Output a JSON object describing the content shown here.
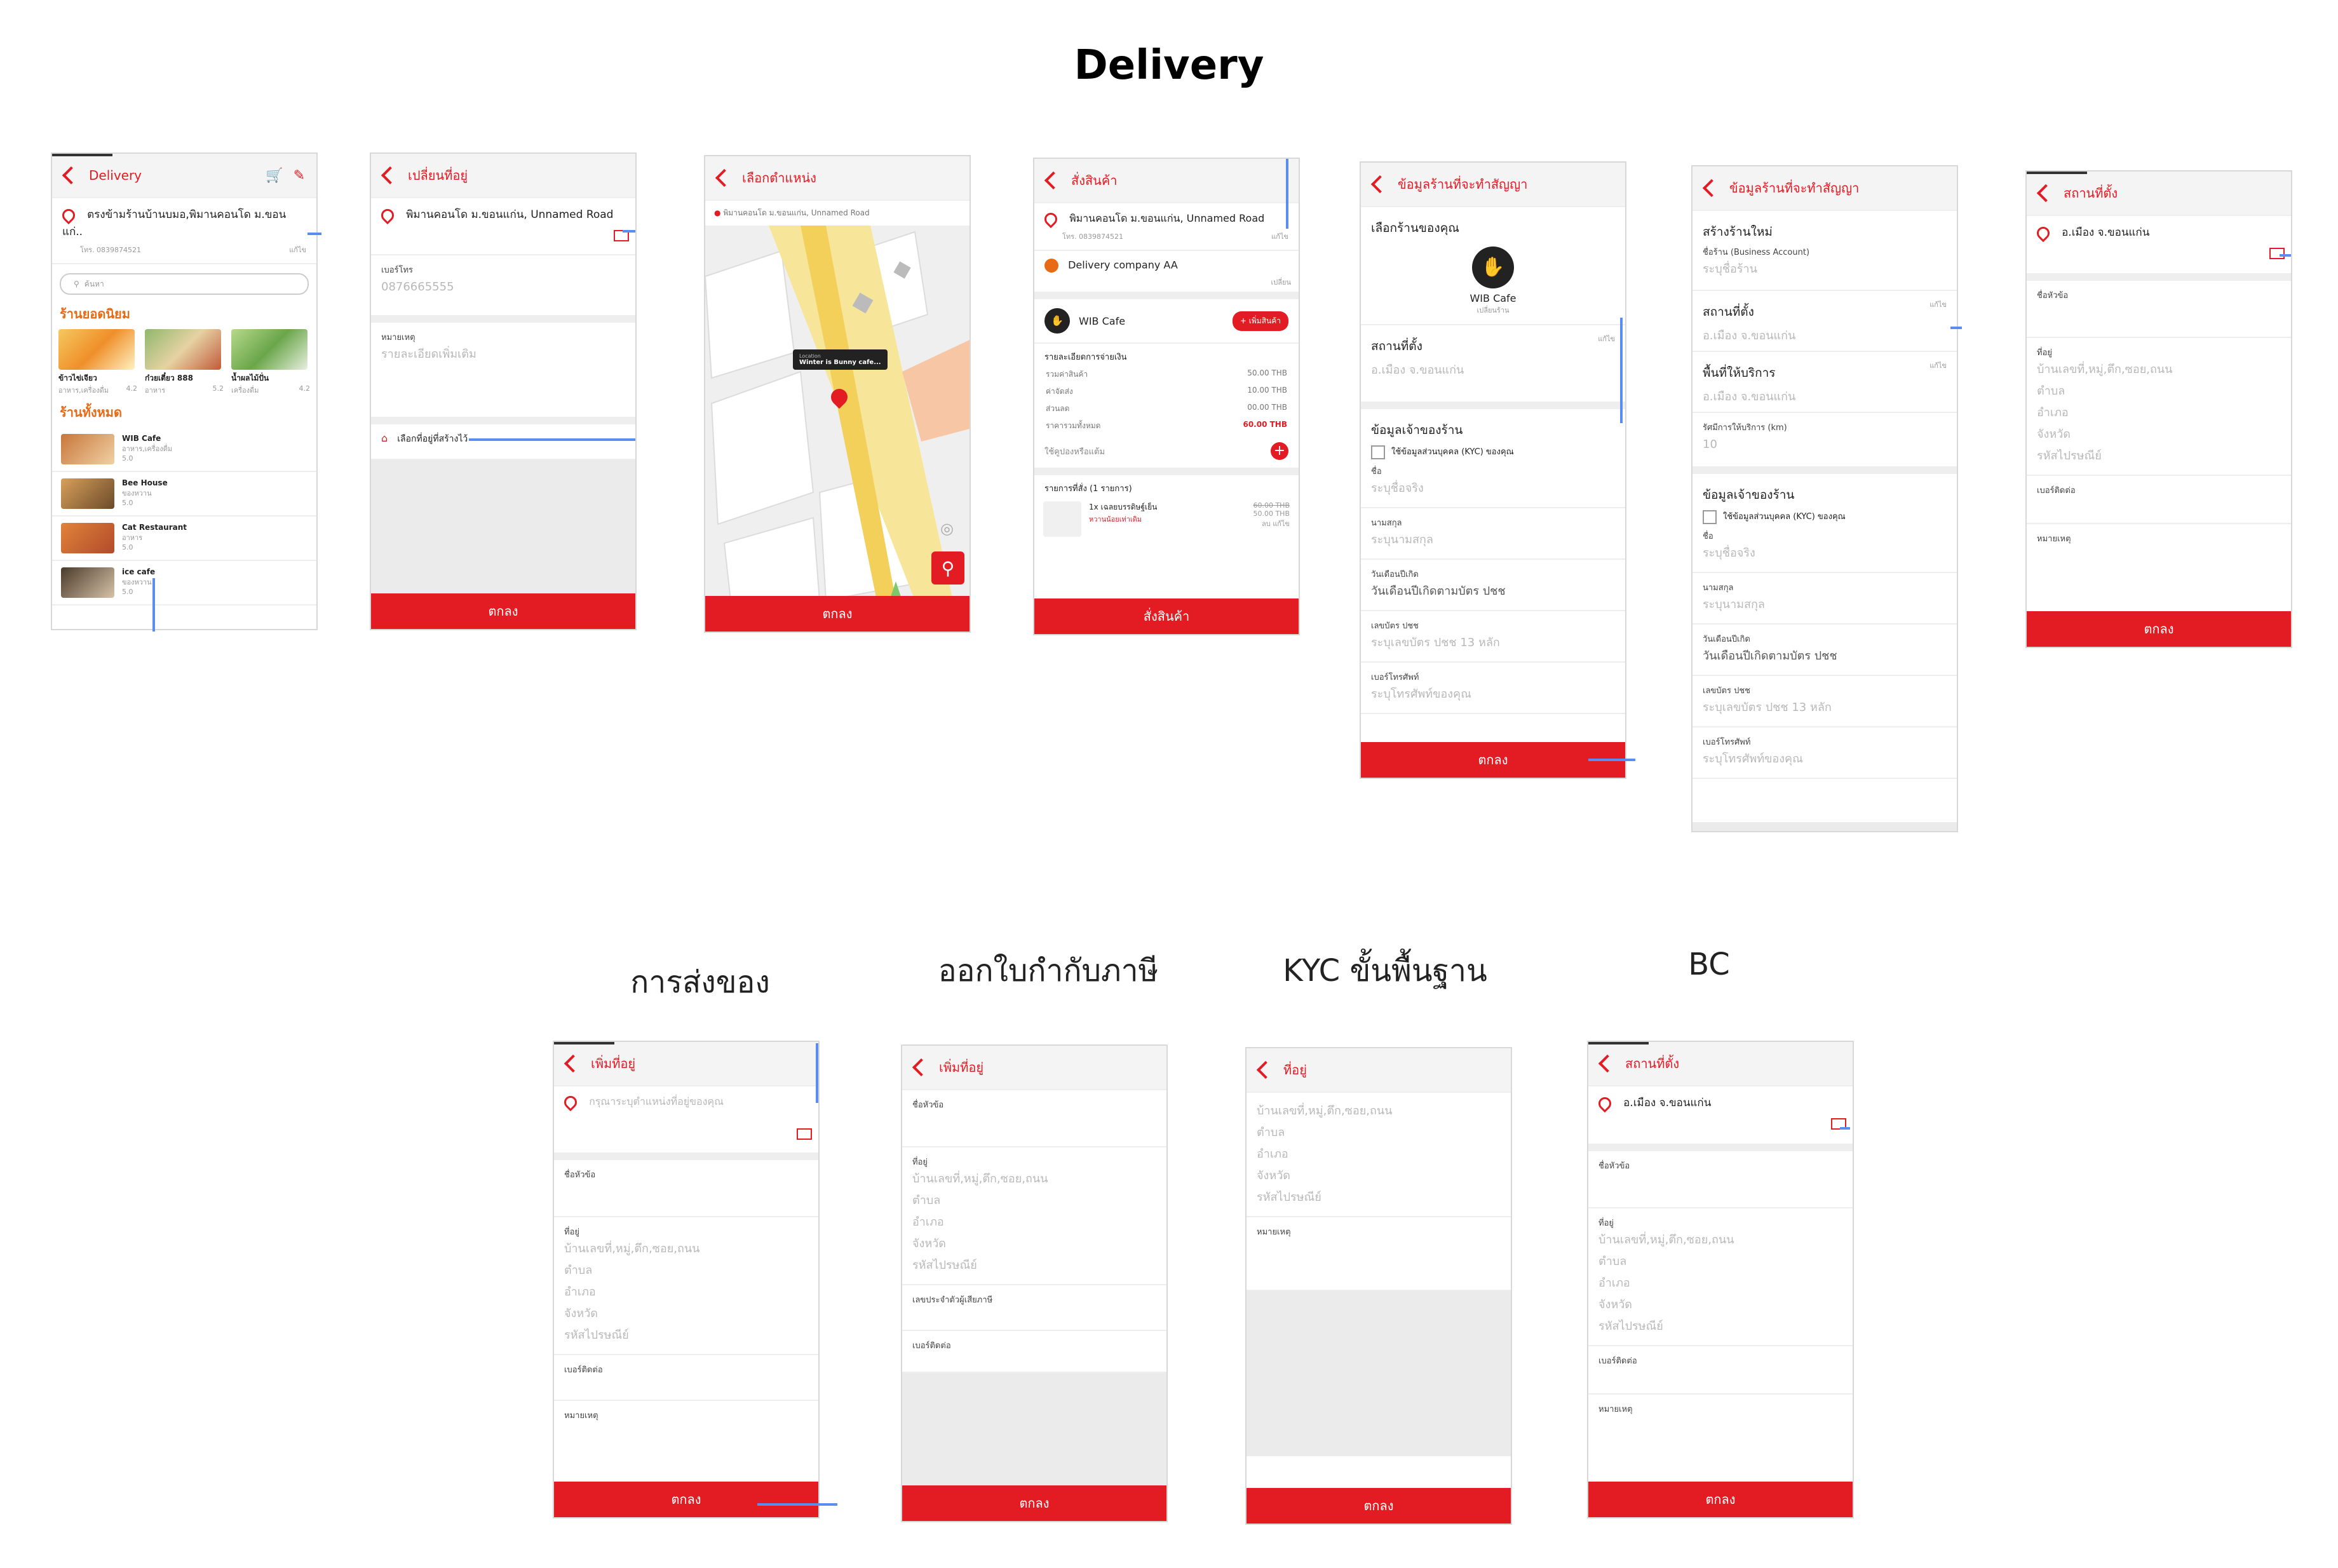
{
  "page_title": "Delivery",
  "section_titles": [
    "การส่งของ",
    "ออกใบกำกับภาษี",
    "KYC ขั้นพื้นฐาน",
    "BC"
  ],
  "s1": {
    "title": "Delivery",
    "address": "ตรงข้ามร้านบ้านบมอ,พิมานคอนโด ม.ขอนแก่..",
    "phone": "โทร. 0839874521",
    "edit": "แก้ไข",
    "search_placeholder": "ค้นหา",
    "popular_title": "ร้านยอดนิยม",
    "popular": [
      {
        "name": "ข้าวไข่เจียว",
        "sub": "อาหาร,เครื่องดื่ม",
        "rating": "4.2"
      },
      {
        "name": "ก๋วยเตี๋ยว 888",
        "sub": "อาหาร",
        "rating": "5.2"
      },
      {
        "name": "น้ำผลไม้ปั่น",
        "sub": "เครื่องดื่ม",
        "rating": "4.2"
      }
    ],
    "all_title": "ร้านทั้งหมด",
    "shops": [
      {
        "name": "WIB Cafe",
        "sub": "อาหาร,เครื่องดื่ม",
        "rating": "5.0"
      },
      {
        "name": "Bee House",
        "sub": "ของหวาน",
        "rating": "5.0"
      },
      {
        "name": "Cat Restaurant",
        "sub": "อาหาร",
        "rating": "5.0"
      },
      {
        "name": "ice cafe",
        "sub": "ของหวาน",
        "rating": "5.0"
      }
    ]
  },
  "s2": {
    "title": "เปลี่ยนที่อยู่",
    "address": "พิมานคอนโด ม.ขอนแก่น, Unnamed Road",
    "phone_label": "เบอร์โทร",
    "phone_value": "0876665555",
    "note_label": "หมายเหตุ",
    "note_placeholder": "รายละเอียดเพิ่มเติม",
    "saved_link": "เลือกที่อยู่ที่สร้างไว้",
    "ok": "ตกลง"
  },
  "s3": {
    "title": "เลือกตำแหน่ง",
    "address": "พิมานคอนโด ม.ขอนแก่น, Unnamed Road",
    "tooltip_small": "Location",
    "tooltip": "Winter is Bunny cafe...",
    "ok": "ตกลง"
  },
  "s4": {
    "title": "สั่งสินค้า",
    "address": "พิมานคอนโด ม.ขอนแก่น, Unnamed Road",
    "phone": "โทร. 0839874521",
    "edit": "แก้ไข",
    "company": "Delivery company AA",
    "change": "เปลี่ยน",
    "shop": "WIB Cafe",
    "add_btn": "+ เพิ่มสินค้า",
    "payment_title": "รายละเอียดการจ่ายเงิน",
    "rows": [
      {
        "label": "รวมค่าสินค้า",
        "value": "50.00 THB"
      },
      {
        "label": "ค่าจัดส่ง",
        "value": "10.00 THB"
      },
      {
        "label": "ส่วนลด",
        "value": "00.00 THB"
      }
    ],
    "total_label": "ราคารวมทั้งหมด",
    "total_value": "60.00 THB",
    "coupon": "ใช้คูปองหรือแต้ม",
    "items_title": "รายการที่สั่ง (1 รายการ)",
    "item": "1x เฉลยบรรดิษฐ์เย็น",
    "item_note": "หวานน้อยเท่าเดิม",
    "old_price": "60.00 THB",
    "price": "50.00 THB",
    "actions": "ลบ แก้ไข",
    "ok": "สั่งสินค้า"
  },
  "s5": {
    "title": "ข้อมูลร้านที่จะทำสัญญา",
    "choose": "เลือกร้านของคุณ",
    "shop": "WIB Cafe",
    "change": "เปลี่ยนร้าน",
    "loc_label": "สถานที่ตั้ง",
    "edit": "แก้ไข",
    "loc_value": "อ.เมือง จ.ขอนแก่น",
    "owner_title": "ข้อมูลเจ้าของร้าน",
    "kyc": "ใช้ข้อมูลส่วนบุคคล (KYC) ของคุณ",
    "fields": [
      {
        "label": "ชื่อ",
        "value": "ระบุชื่อจริง"
      },
      {
        "label": "นามสกุล",
        "value": "ระบุนามสกุล"
      },
      {
        "label": "วันเดือนปีเกิด",
        "value": "วันเดือนปีเกิดตามบัตร ปชช"
      },
      {
        "label": "เลขบัตร ปชช",
        "value": "ระบุเลขบัตร ปชช 13 หลัก"
      },
      {
        "label": "เบอร์โทรศัพท์",
        "value": "ระบุโทรศัพท์ของคุณ"
      }
    ],
    "ok": "ตกลง"
  },
  "s6": {
    "title": "ข้อมูลร้านที่จะทำสัญญา",
    "create": "สร้างร้านใหม่",
    "biz_label": "ชื่อร้าน (Business Account)",
    "biz_ph": "ระบุชื่อร้าน",
    "loc_label": "สถานที่ตั้ง",
    "loc_value": "อ.เมือง จ.ขอนแก่น",
    "area_label": "พื้นที่ให้บริการ",
    "area_value": "อ.เมือง จ.ขอนแก่น",
    "edit": "แก้ไข",
    "radius_label": "รัศมีการให้บริการ (km)",
    "radius_value": "10",
    "owner_title": "ข้อมูลเจ้าของร้าน",
    "kyc": "ใช้ข้อมูลส่วนบุคคล (KYC) ของคุณ",
    "fields": [
      {
        "label": "ชื่อ",
        "value": "ระบุชื่อจริง"
      },
      {
        "label": "นามสกุล",
        "value": "ระบุนามสกุล"
      },
      {
        "label": "วันเดือนปีเกิด",
        "value": "วันเดือนปีเกิดตามบัตร ปชช"
      },
      {
        "label": "เลขบัตร ปชช",
        "value": "ระบุเลขบัตร ปชช 13 หลัก"
      },
      {
        "label": "เบอร์โทรศัพท์",
        "value": "ระบุโทรศัพท์ของคุณ"
      }
    ]
  },
  "s7": {
    "title": "สถานที่ตั้ง",
    "address": "อ.เมือง จ.ขอนแก่น",
    "name_label": "ชื่อหัวข้อ",
    "addr_label": "ที่อยู่",
    "addr_lines": [
      "บ้านเลขที่,หมู่,ตึก,ซอย,ถนน",
      "ตำบล",
      "อำเภอ",
      "จังหวัด",
      "รหัสไปรษณีย์"
    ],
    "contact_label": "เบอร์ติดต่อ",
    "note_label": "หมายเหตุ",
    "ok": "ตกลง"
  },
  "b1": {
    "title": "เพิ่มที่อยู่",
    "address_ph": "กรุณาระบุตำแหน่งที่อยู่ของคุณ",
    "name_label": "ชื่อหัวข้อ",
    "addr_label": "ที่อยู่",
    "addr_lines": [
      "บ้านเลขที่,หมู่,ตึก,ซอย,ถนน",
      "ตำบล",
      "อำเภอ",
      "จังหวัด",
      "รหัสไปรษณีย์"
    ],
    "contact_label": "เบอร์ติดต่อ",
    "note_label": "หมายเหตุ",
    "ok": "ตกลง"
  },
  "b2": {
    "title": "เพิ่มที่อยู่",
    "name_label": "ชื่อหัวข้อ",
    "addr_label": "ที่อยู่",
    "addr_lines": [
      "บ้านเลขที่,หมู่,ตึก,ซอย,ถนน",
      "ตำบล",
      "อำเภอ",
      "จังหวัด",
      "รหัสไปรษณีย์"
    ],
    "tax_label": "เลขประจำตัวผู้เสียภาษี",
    "contact_label": "เบอร์ติดต่อ",
    "ok": "ตกลง"
  },
  "b3": {
    "title": "ที่อยู่",
    "addr_lines": [
      "บ้านเลขที่,หมู่,ตึก,ซอย,ถนน",
      "ตำบล",
      "อำเภอ",
      "จังหวัด",
      "รหัสไปรษณีย์"
    ],
    "note_label": "หมายเหตุ",
    "ok": "ตกลง"
  },
  "b4": {
    "title": "สถานที่ตั้ง",
    "address": "อ.เมือง จ.ขอนแก่น",
    "name_label": "ชื่อหัวข้อ",
    "addr_label": "ที่อยู่",
    "addr_lines": [
      "บ้านเลขที่,หมู่,ตึก,ซอย,ถนน",
      "ตำบล",
      "อำเภอ",
      "จังหวัด",
      "รหัสไปรษณีย์"
    ],
    "contact_label": "เบอร์ติดต่อ",
    "note_label": "หมายเหตุ",
    "ok": "ตกลง"
  },
  "colors": {
    "accent": "#e31b23",
    "popular": "#e86a14",
    "connector": "#5b8def"
  }
}
